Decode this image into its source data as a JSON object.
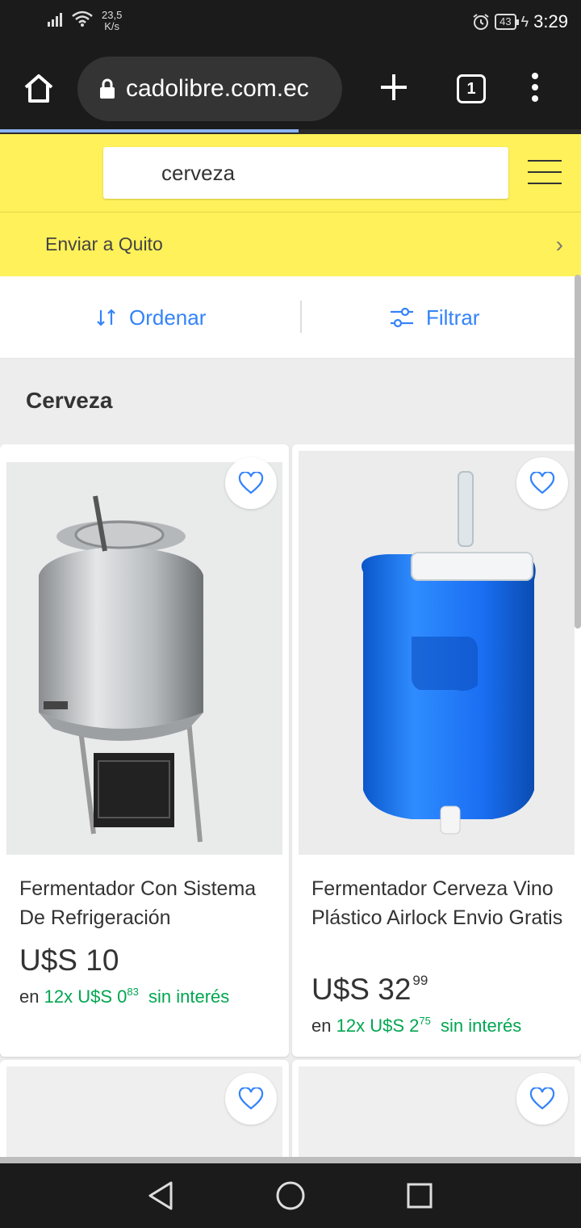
{
  "status_bar": {
    "net_speed_value": "23,5",
    "net_speed_unit": "K/s",
    "battery": "43",
    "time": "3:29"
  },
  "browser": {
    "url": "cadolibre.com.ec",
    "tab_count": "1"
  },
  "header": {
    "search_value": "cerveza",
    "ship_to": "Enviar a Quito"
  },
  "toolbar": {
    "sort_label": "Ordenar",
    "filter_label": "Filtrar"
  },
  "section": {
    "title": "Cerveza"
  },
  "products": [
    {
      "title": "Fermentador Con Sistema De Refrigeración",
      "currency": "U$S",
      "price_int": "10",
      "price_cents": "",
      "inst_prefix": "en",
      "inst_count": "12x",
      "inst_currency": "U$S",
      "inst_int": "0",
      "inst_cents": "83",
      "inst_suffix": "sin interés",
      "image_desc": "stainless-steel-fermenter"
    },
    {
      "title": "Fermentador Cerveza Vino Plástico Airlock Envio Gratis",
      "currency": "U$S",
      "price_int": "32",
      "price_cents": "99",
      "inst_prefix": "en",
      "inst_count": "12x",
      "inst_currency": "U$S",
      "inst_int": "2",
      "inst_cents": "75",
      "inst_suffix": "sin interés",
      "image_desc": "blue-plastic-fermenter"
    }
  ],
  "colors": {
    "brand_yellow": "#fff159",
    "link_blue": "#3483fa",
    "green": "#00a650"
  }
}
